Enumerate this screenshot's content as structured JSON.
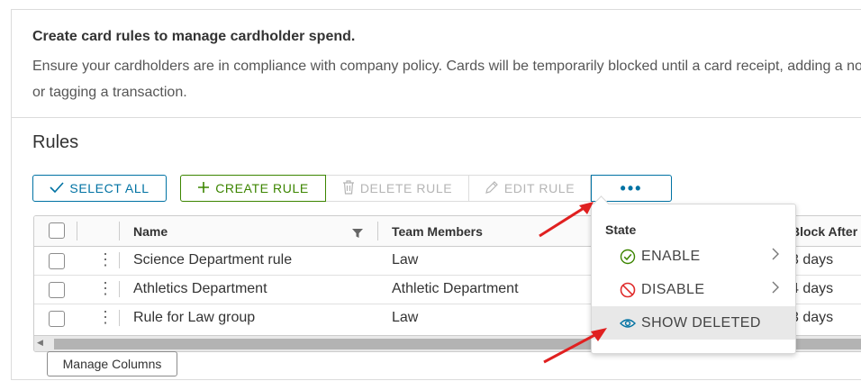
{
  "intro": {
    "title": "Create card rules to manage cardholder spend.",
    "description": "Ensure your cardholders are in compliance with company policy. Cards will be temporarily blocked until a card receipt, adding a note, or tagging a transaction."
  },
  "section": {
    "title": "Rules"
  },
  "toolbar": {
    "select_all": "SELECT ALL",
    "create_rule": "CREATE RULE",
    "delete_rule": "DELETE RULE",
    "edit_rule": "EDIT RULE",
    "more": "•••"
  },
  "grid": {
    "columns": {
      "name": "Name",
      "team_members": "Team Members",
      "block_after": "Block After"
    },
    "rows": [
      {
        "name": "Science Department rule",
        "team_members": "Law",
        "block_after": "3 days"
      },
      {
        "name": "Athletics Department",
        "team_members": "Athletic Department",
        "block_after": "4 days"
      },
      {
        "name": "Rule for Law group",
        "team_members": "Law",
        "block_after": "3 days"
      }
    ]
  },
  "footer": {
    "manage_columns": "Manage Columns"
  },
  "dropdown": {
    "header": "State",
    "items": [
      {
        "label": "ENABLE",
        "icon": "check-circle-icon"
      },
      {
        "label": "DISABLE",
        "icon": "ban-icon"
      },
      {
        "label": "SHOW DELETED",
        "icon": "eye-icon"
      }
    ]
  },
  "colors": {
    "primary": "#0072a3",
    "success": "#3c8500",
    "danger": "#e02b2b",
    "annotation_arrow": "#e02020"
  }
}
